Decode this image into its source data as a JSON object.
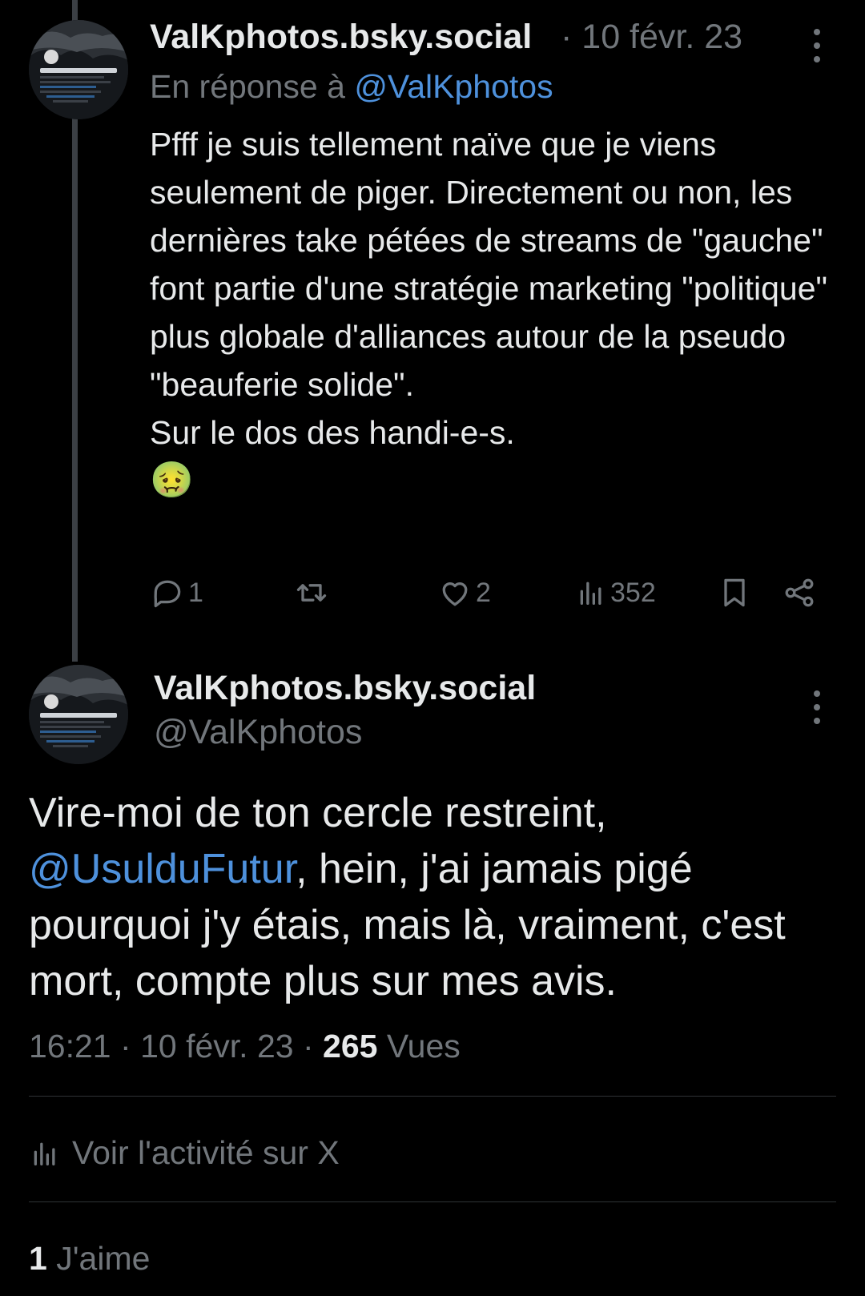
{
  "reply": {
    "name": "ValKphotos.bsky.social",
    "separator": "·",
    "date": "10 févr. 23",
    "in_reply_prefix": "En réponse à",
    "in_reply_handle": "@ValKphotos",
    "text": "Pfff je suis tellement naïve que je viens seulement de piger. Directement ou non, les dernières take pétées de streams de \"gauche\" font partie d'une stratégie marketing \"politique\" plus globale d'alliances autour de la pseudo \"beauferie solide\".\nSur le dos des handi-e-s.",
    "emoji": "🤢",
    "actions": {
      "reply_count": "1",
      "like_count": "2",
      "view_count": "352"
    },
    "avatar_text": "ValK 📚 #InactionDirecte"
  },
  "main": {
    "name": "ValKphotos.bsky.social",
    "handle": "@ValKphotos",
    "text_before": "Vire-moi de ton cercle restreint, ",
    "mention": "@UsulduFutur",
    "text_after": ", hein, j'ai jamais pigé pourquoi j'y étais, mais là, vraiment, c'est mort, compte plus sur mes avis.",
    "time": "16:21",
    "date": "10 févr. 23",
    "dot": "·",
    "views_count": "265",
    "views_label": "Vues",
    "activity_label": "Voir l'activité sur X",
    "likes_count": "1",
    "likes_label": "J'aime",
    "avatar_text": "ValK 📚 #InactionDirecte"
  },
  "colors": {
    "background": "#000000",
    "text": "#e7e9ea",
    "muted": "#71767b",
    "link": "#4e91dc"
  }
}
